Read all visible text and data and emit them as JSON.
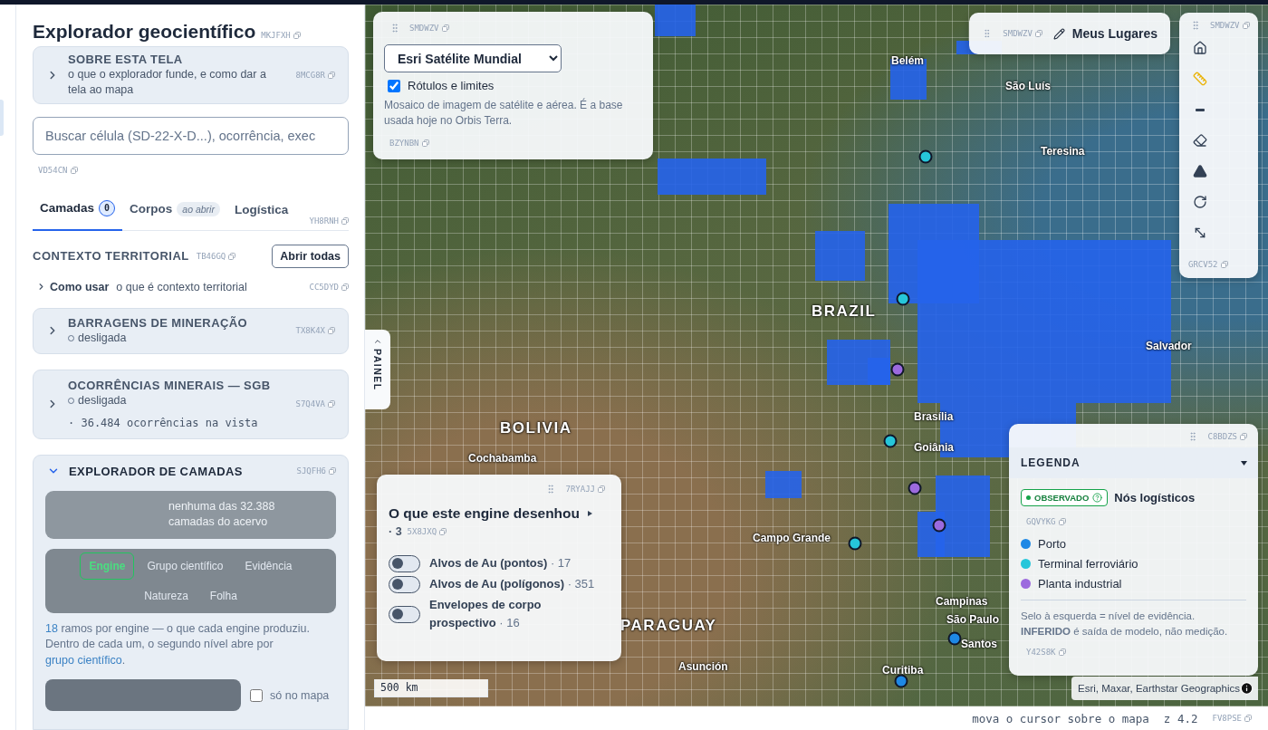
{
  "sidebar": {
    "title": "Explorador geocientífico",
    "title_code": "MKJFXH",
    "about": {
      "title": "SOBRE ESTA TELA",
      "subtitle": "o que o explorador funde, e como dar a tela ao mapa",
      "code": "8MCG8R",
      "expanded": false
    },
    "search": {
      "placeholder": "Buscar célula (SD-22-X-D...), ocorrência, exec",
      "code": "VD54CN"
    },
    "tabs": [
      {
        "label": "Camadas",
        "badge": "0",
        "kind": "count",
        "selected": true
      },
      {
        "label": "Corpos",
        "badge": "ao abrir",
        "kind": "note",
        "selected": false
      },
      {
        "label": "Logística",
        "kind": "plain",
        "selected": false
      }
    ],
    "tabs_code": "YH8RNH",
    "section": {
      "title": "CONTEXTO TERRITORIAL",
      "code": "TB46GQ",
      "button": "Abrir todas"
    },
    "howto": {
      "label": "Como usar",
      "text": "o que é contexto territorial",
      "code": "CC5DYD"
    },
    "cards": [
      {
        "title": "BARRAGENS DE MINERAÇÃO",
        "status": "desligada",
        "code": "TX8K4X",
        "expanded": false
      },
      {
        "title": "OCORRÊNCIAS MINERAIS — SGB",
        "status": "desligada",
        "detail": "· 36.484 ocorrências na vista",
        "code": "S7Q4VA",
        "expanded": false
      }
    ],
    "explorer": {
      "title": "EXPLORADOR DE CAMADAS",
      "code": "SJQFH6",
      "expanded": true,
      "summary": "nenhuma das 32.388 camadas do acervo",
      "groupings": [
        {
          "label": "Engine",
          "selected": true
        },
        {
          "label": "Grupo científico",
          "selected": false
        },
        {
          "label": "Evidência",
          "selected": false
        },
        {
          "label": "Natureza",
          "selected": false
        },
        {
          "label": "Folha",
          "selected": false
        }
      ],
      "note": [
        {
          "text": "18",
          "kind": "link"
        },
        {
          "text": " ramos por engine — o que cada engine produziu. Dentro de cada um, o segundo nível abre por ",
          "kind": "plain"
        },
        {
          "text": "grupo científico",
          "kind": "link"
        },
        {
          "text": ".",
          "kind": "plain"
        }
      ],
      "only_map": {
        "label": "só no mapa",
        "checked": false
      }
    }
  },
  "map": {
    "basemap": {
      "code": "SMDWZV",
      "select": "Esri Satélite Mundial",
      "labels": {
        "label": "Rótulos e limites",
        "checked": true
      },
      "description": "Mosaico de imagem de satélite e aérea. É a base usada hoje no Orbis Terra.",
      "footer_code": "BZYNBN"
    },
    "places": {
      "code": "SMDWZV",
      "label": "Meus Lugares"
    },
    "tools": {
      "code": "SMDWZV",
      "footer_code": "GRCV52"
    },
    "panel_tab": {
      "label": "PAINEL"
    },
    "engine_panel": {
      "code": "7RYAJJ",
      "title": "O que este engine desenhou",
      "count": "· 3",
      "count_code": "5X8JXQ",
      "layers": [
        {
          "label": "Alvos de Au (pontos)",
          "count": "· 17",
          "on": false
        },
        {
          "label": "Alvos de Au (polígonos)",
          "count": "· 351",
          "on": false
        },
        {
          "label": "Envelopes de corpo prospectivo",
          "count": "· 16",
          "on": false
        }
      ]
    },
    "scale": "500 km",
    "legend": {
      "code": "C8BDZS",
      "title": "LEGENDA",
      "expanded": true,
      "badge": "OBSERVADO",
      "group": "Nós logísticos",
      "group_code": "GQVYKG",
      "items": [
        {
          "label": "Porto",
          "color": "#1e88e5"
        },
        {
          "label": "Terminal ferroviário",
          "color": "#26c6da"
        },
        {
          "label": "Planta industrial",
          "color": "#9c6ade"
        }
      ],
      "note": "Selo à esquerda = nível de evidência. **INFERIDO** é saída de modelo, não medição.",
      "note_code": "Y42S8K"
    },
    "attribution": "Esri, Maxar, Earthstar Geographics",
    "labels": [
      {
        "text": "Belém",
        "kind": "city"
      },
      {
        "text": "São Luís",
        "kind": "city"
      },
      {
        "text": "Teresina",
        "kind": "city"
      },
      {
        "text": "BRAZIL",
        "kind": "country"
      },
      {
        "text": "Salvador",
        "kind": "city"
      },
      {
        "text": "Brasília",
        "kind": "city"
      },
      {
        "text": "Goiânia",
        "kind": "city"
      },
      {
        "text": "BOLIVIA",
        "kind": "country"
      },
      {
        "text": "Cochabamba",
        "kind": "city"
      },
      {
        "text": "Campo Grande",
        "kind": "city"
      },
      {
        "text": "Campinas",
        "kind": "city"
      },
      {
        "text": "São Paulo",
        "kind": "city"
      },
      {
        "text": "Santos",
        "kind": "city"
      },
      {
        "text": "Curitiba",
        "kind": "city"
      },
      {
        "text": "PARAGUAY",
        "kind": "country"
      },
      {
        "text": "Asunción",
        "kind": "city"
      }
    ]
  },
  "status_bar": {
    "hint": "mova o cursor sobre o mapa",
    "zoom": "z 4.2",
    "code": "FV8PSE"
  }
}
